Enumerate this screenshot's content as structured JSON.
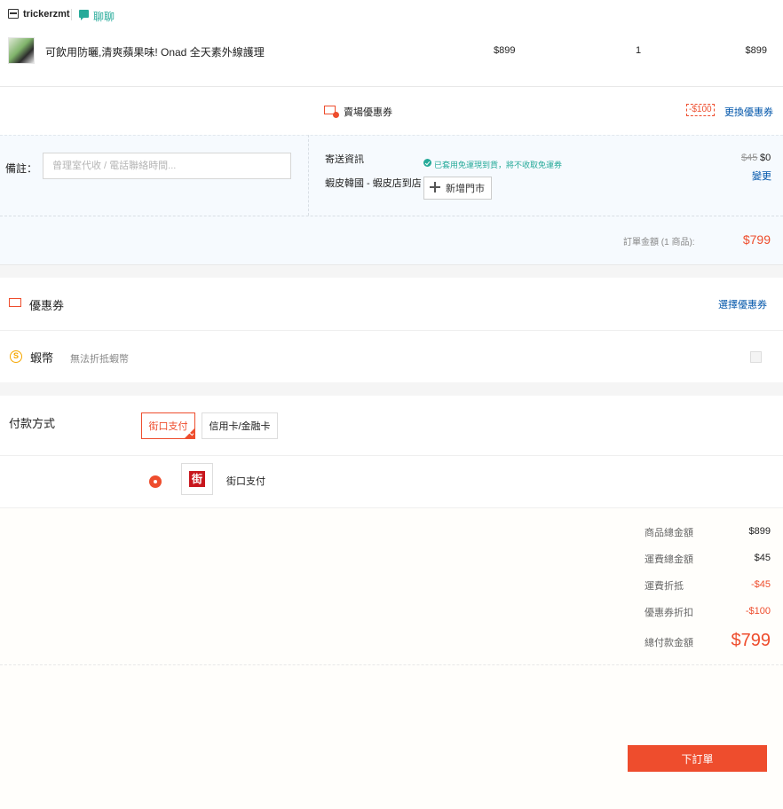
{
  "shop": {
    "name": "trickerzmt",
    "chat_label": "聊聊"
  },
  "product": {
    "name": "可飲用防曬,清爽蘋果味! Onad 全天素外線護理",
    "unit_price": "$899",
    "quantity": "1",
    "subtotal": "$899"
  },
  "shop_voucher": {
    "label": "賣場優惠券",
    "badge": "-$100",
    "change_link": "更換優惠券"
  },
  "notes": {
    "label": "備註：",
    "placeholder": "曾理室代收 / 電話聯絡時間..."
  },
  "shipping": {
    "title": "寄送資訊",
    "free_note": "已套用免運現到貨，將不收取免運券",
    "method": "蝦皮韓國 - 蝦皮店到店",
    "add_store": "新增門市",
    "old_fee": "$45",
    "new_fee": "$0",
    "change": "變更"
  },
  "order_total": {
    "label": "訂單金額 (1 商品):",
    "value": "$799"
  },
  "platform_voucher": {
    "label": "優惠券",
    "link": "選擇優惠券"
  },
  "coins": {
    "label": "蝦幣",
    "note": "無法折抵蝦幣",
    "icon_char": "S"
  },
  "payment": {
    "title": "付款方式",
    "tabs": [
      "街口支付",
      "信用卡/金融卡"
    ],
    "selected_logo_char": "街",
    "selected_name": "街口支付"
  },
  "summary": {
    "rows": [
      {
        "label": "商品總金額",
        "value": "$899"
      },
      {
        "label": "運費總金額",
        "value": "$45"
      },
      {
        "label": "運費折抵",
        "value": "-$45"
      },
      {
        "label": "優惠券折扣",
        "value": "-$100"
      }
    ],
    "total_label": "總付款金額",
    "total_value": "$799"
  },
  "place_order": "下訂單",
  "colors": {
    "accent": "#ee4d2d",
    "link": "#0055aa",
    "green": "#26aa99",
    "coin": "#f6a700"
  }
}
